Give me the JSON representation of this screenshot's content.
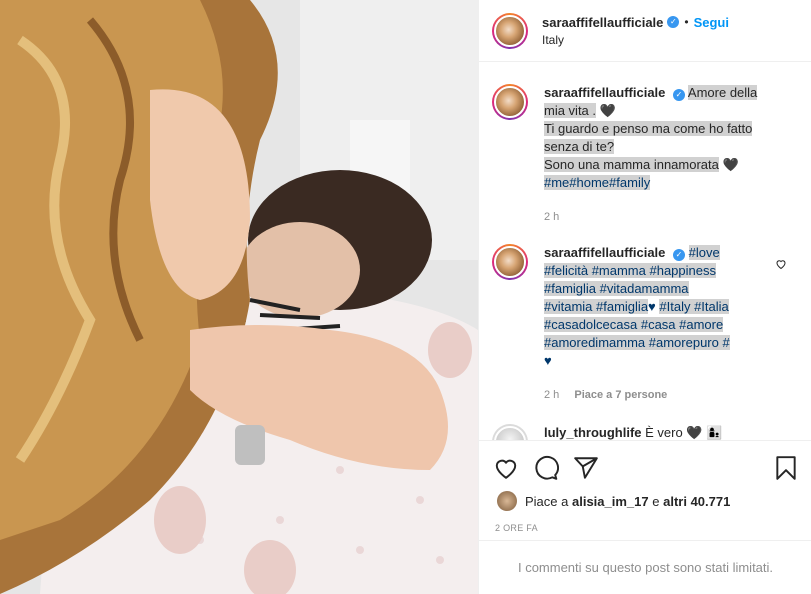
{
  "header": {
    "username": "saraaffifellaufficiale",
    "separator": "•",
    "follow_label": "Segui",
    "location": "Italy"
  },
  "caption": {
    "username": "saraaffifellaufficiale",
    "lines": [
      "Amore della",
      "mia vita .",
      "Ti guardo e penso ma come ho fatto",
      "senza di te?",
      "Sono una mamma innamorata"
    ],
    "hashtags": "#me#home#family",
    "time": "2 h"
  },
  "comment2": {
    "username": "saraaffifellaufficiale",
    "lines": [
      "#love",
      "#felicità #mamma #happiness",
      "#famiglia #vitadamamma",
      "#vitamia #famiglia",
      "#casadolcecasa #casa #amore",
      "#amoredimamma #amorepuro #"
    ],
    "italy_tags": "#Italy #Italia",
    "time": "2 h",
    "likes": "Piace a 7 persone"
  },
  "comment3": {
    "username": "luly_throughlife",
    "text": "È vero"
  },
  "likes": {
    "prefix": "Piace a",
    "user": "alisia_im_17",
    "middle": "e",
    "others": "altri 40.771"
  },
  "timeago": "2 ORE FA",
  "limited_notice": "I commenti su questo post sono stati limitati.",
  "colors": {
    "accent_blue": "#0095f6",
    "verified": "#3897f0",
    "hashtag": "#00376b",
    "muted": "#8e8e8e",
    "highlight": "#d1d1d1"
  },
  "icons": [
    "verified-icon",
    "heart-icon",
    "comment-icon",
    "share-icon",
    "bookmark-icon",
    "black-heart-icon",
    "blue-heart-icon"
  ]
}
